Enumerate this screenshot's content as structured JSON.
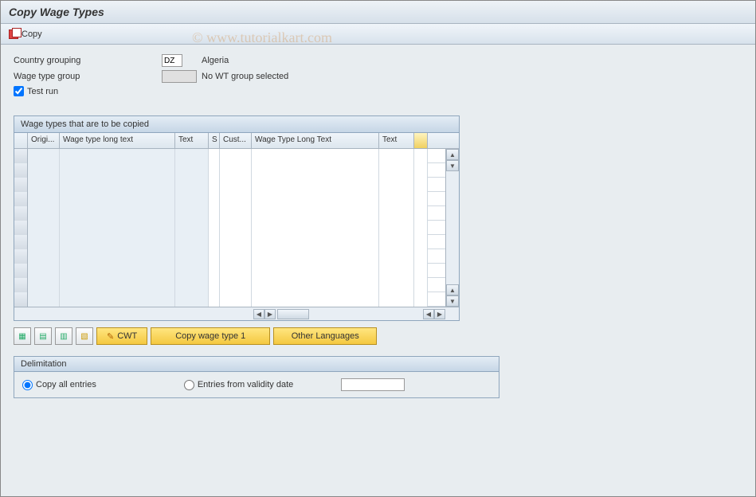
{
  "title": "Copy Wage Types",
  "toolbar": {
    "copy_label": "Copy"
  },
  "watermark": "© www.tutorialkart.com",
  "form": {
    "country_label": "Country grouping",
    "country_value": "DZ",
    "country_text": "Algeria",
    "wt_group_label": "Wage type group",
    "wt_group_value": "",
    "wt_group_text": "No WT group selected",
    "test_run_label": "Test run",
    "test_run_checked": true
  },
  "grid": {
    "title": "Wage types that are to be copied",
    "columns": {
      "origi": "Origi...",
      "wt_long": "Wage type long text",
      "text1": "Text",
      "s": "S",
      "cust": "Cust...",
      "wt_long2": "Wage Type Long Text",
      "text2": "Text"
    },
    "row_count": 11
  },
  "buttons": {
    "cwt": "CWT",
    "copy_wt1": "Copy wage type 1",
    "other_lang": "Other Languages"
  },
  "delim": {
    "title": "Delimitation",
    "copy_all": "Copy all entries",
    "from_date": "Entries from validity date",
    "date_value": ""
  }
}
